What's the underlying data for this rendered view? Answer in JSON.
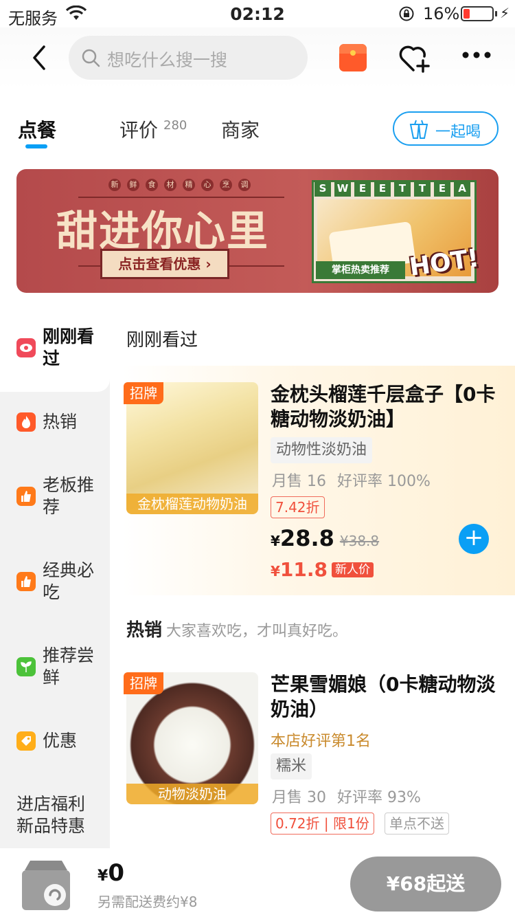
{
  "status_bar": {
    "carrier": "无服务",
    "time": "02:12",
    "battery": "16%",
    "battery_level": 0.16
  },
  "nav": {
    "search_placeholder": "想吃什么搜一搜"
  },
  "tabs": [
    {
      "label": "点餐",
      "active": true
    },
    {
      "label": "评价",
      "count": "280"
    },
    {
      "label": "商家"
    }
  ],
  "together_button": "一起喝",
  "banner": {
    "top_text": [
      "新",
      "鲜",
      "食",
      "材",
      "精",
      "心",
      "烹",
      "调"
    ],
    "headline": "甜进你心里",
    "cta": "点击查看优惠 ›",
    "sweet_letters": [
      "S",
      "W",
      "E",
      "E",
      "T",
      "T",
      "E",
      "A"
    ],
    "plaque": "掌柜热卖推荐",
    "hot": "HOT!"
  },
  "sidebar": [
    {
      "label": "刚刚看过",
      "icon": "eye-icon",
      "color": "#f04a5a",
      "active": true
    },
    {
      "label": "热销",
      "icon": "flame-icon",
      "color": "#ff5a2a"
    },
    {
      "label": "老板推荐",
      "icon": "thumbs-up-icon",
      "color": "#ff7a1a"
    },
    {
      "label": "经典必吃",
      "icon": "thumbs-up-icon",
      "color": "#ff7a1a"
    },
    {
      "label": "推荐尝鲜",
      "icon": "sprout-icon",
      "color": "#4cc23a"
    },
    {
      "label": "优惠",
      "icon": "tag-icon",
      "color": "#ffae1a"
    },
    {
      "label": "进店福利新品特惠"
    }
  ],
  "sections": {
    "recent": {
      "title": "刚刚看过"
    },
    "hot": {
      "title": "热销",
      "subtitle": "大家喜欢吃，才叫真好吃。"
    }
  },
  "products": [
    {
      "badge": "招牌",
      "image_caption": "金枕榴莲动物奶油",
      "name": "金枕头榴莲千层盒子【0卡糖动物淡奶油】",
      "tag": "动物性淡奶油",
      "monthly_sales": "月售 16",
      "rating": "好评率 100%",
      "discount": "7.42折",
      "currency": "¥",
      "price": "28.8",
      "original_price": "¥38.8",
      "new_user_price": "11.8",
      "new_user_tag": "新人价"
    },
    {
      "badge": "招牌",
      "image_caption": "动物淡奶油",
      "name": "芒果雪媚娘（0卡糖动物淡奶油）",
      "rank": "本店好评第1名",
      "tag": "糯米",
      "monthly_sales": "月售 30",
      "rating": "好评率 93%",
      "discount": "0.72折",
      "limit": "限1份",
      "no_delivery": "单点不送"
    }
  ],
  "cart": {
    "currency": "¥",
    "total": "0",
    "delivery_fee": "另需配送费约¥8",
    "min_order": "¥68起送"
  },
  "colors": {
    "accent": "#0a9ff5",
    "brand_orange": "#ff6c1a",
    "price_red": "#f0503c"
  }
}
